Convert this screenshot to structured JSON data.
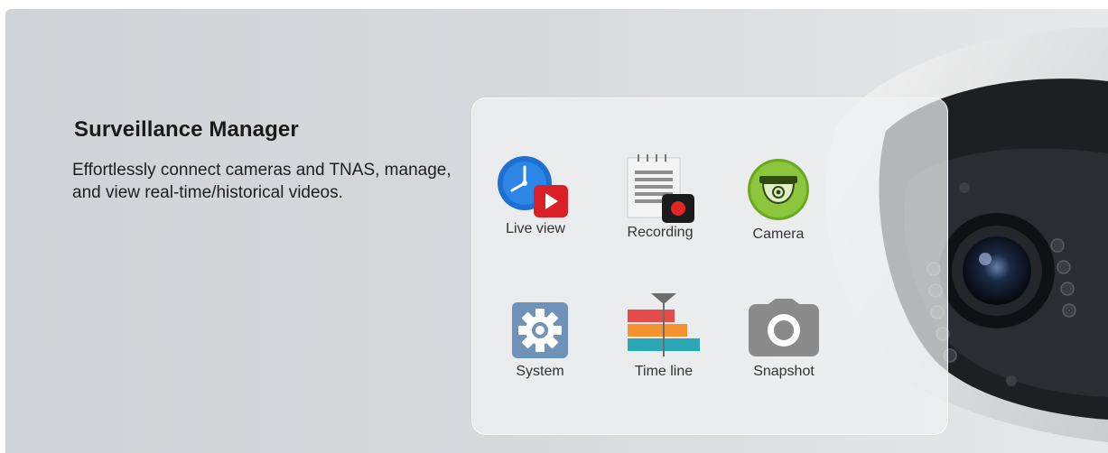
{
  "hero": {
    "title": "Surveillance Manager",
    "description": "Effortlessly connect cameras and TNAS, manage, and view real-time/historical videos."
  },
  "apps": [
    {
      "label": "Live view",
      "icon": "live-view-icon"
    },
    {
      "label": "Recording",
      "icon": "recording-icon"
    },
    {
      "label": "Camera",
      "icon": "camera-dome-icon"
    },
    {
      "label": "System",
      "icon": "system-gear-icon"
    },
    {
      "label": "Time line",
      "icon": "timeline-icon"
    },
    {
      "label": "Snapshot",
      "icon": "snapshot-camera-icon"
    }
  ],
  "colors": {
    "background": "#d6d9dc",
    "live_blue": "#1f6fd1",
    "play_red": "#d92027",
    "camera_green": "#7fbf1f",
    "gear_blue": "#6f93b8",
    "timeline_red": "#e54b4b",
    "timeline_orange": "#f5922f",
    "timeline_teal": "#2aa7b4",
    "snapshot_gray": "#8a8a8a"
  }
}
